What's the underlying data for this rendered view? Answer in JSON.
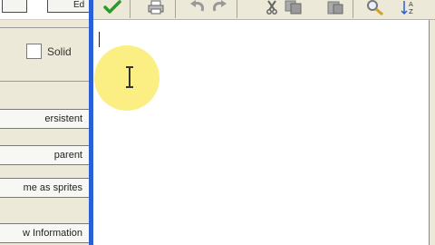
{
  "left_panel": {
    "top_button_partial": "Ed",
    "solid_checkbox_label": "Solid",
    "solid_checked": false,
    "buttons": [
      "ersistent",
      "parent",
      "me as sprites",
      "w Information"
    ]
  },
  "toolbar": {
    "icons": [
      "check-icon",
      "print-icon",
      "undo-icon",
      "redo-icon",
      "cut-icon",
      "copy-icon",
      "paste-icon",
      "find-icon",
      "sort-icon"
    ],
    "sort_label": "A-Z"
  },
  "editor": {
    "content": ""
  },
  "colors": {
    "panel_bg": "#ece9d8",
    "separator": "#2a5fd6",
    "highlight": "#faec6e",
    "check_green": "#2a9a2a"
  }
}
